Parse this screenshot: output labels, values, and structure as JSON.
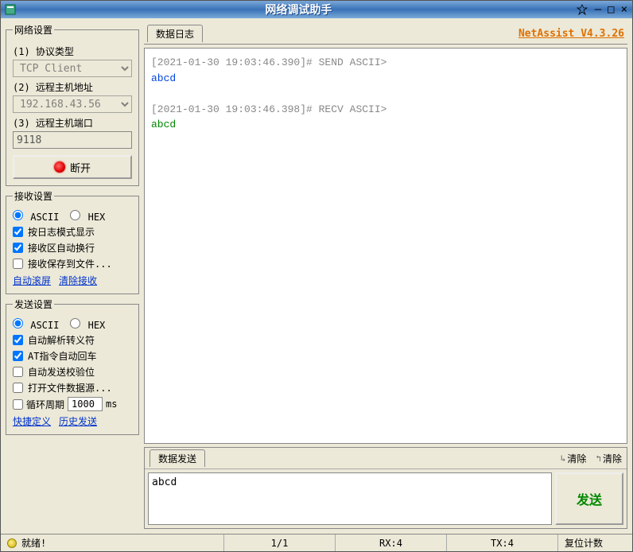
{
  "window": {
    "title": "网络调试助手",
    "min": "—",
    "max": "□",
    "close": "×"
  },
  "brand": "NetAssist V4.3.26",
  "network": {
    "legend": "网络设置",
    "proto_label": "(1) 协议类型",
    "proto_value": "TCP Client",
    "host_label": "(2) 远程主机地址",
    "host_value": "192.168.43.56",
    "port_label": "(3) 远程主机端口",
    "port_value": "9118",
    "disconnect": "断开"
  },
  "recv": {
    "legend": "接收设置",
    "ascii": "ASCII",
    "hex": "HEX",
    "c1": "按日志模式显示",
    "c2": "接收区自动换行",
    "c3": "接收保存到文件...",
    "link1": "自动滚屏",
    "link2": "清除接收"
  },
  "send": {
    "legend": "发送设置",
    "ascii": "ASCII",
    "hex": "HEX",
    "c1": "自动解析转义符",
    "c2": "AT指令自动回车",
    "c3": "自动发送校验位",
    "c4": "打开文件数据源...",
    "cycle_label": "循环周期",
    "cycle_value": "1000",
    "cycle_unit": "ms",
    "link1": "快捷定义",
    "link2": "历史发送"
  },
  "log": {
    "tab": "数据日志",
    "line1_ts": "[2021-01-30 19:03:46.390]# SEND ASCII>",
    "line1_body": "abcd",
    "line2_ts": "[2021-01-30 19:03:46.398]# RECV ASCII>",
    "line2_body": "abcd"
  },
  "sendpanel": {
    "tab": "数据发送",
    "clear1": "清除",
    "clear2": "清除",
    "text": "abcd",
    "button": "发送"
  },
  "status": {
    "ready": "就绪!",
    "pages": "1/1",
    "rx": "RX:4",
    "tx": "TX:4",
    "reset": "复位计数"
  }
}
